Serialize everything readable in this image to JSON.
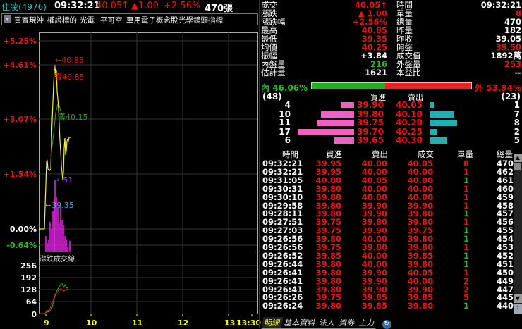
{
  "header": {
    "stock": "佳凌(4976)",
    "time": "09:32:21",
    "price": "40.05",
    "price_arrow": "↑",
    "change": "▲1.00",
    "change_pct": "+2.56%",
    "volume": "470張"
  },
  "tags": [
    "買賣現沖",
    "權證標的",
    "光電",
    "平可空",
    "車用電子概念股",
    "光學鏡頭指標"
  ],
  "info": [
    {
      "l1": "成交",
      "v1": "40.05↑",
      "c1": "r",
      "l2": "時間",
      "v2": "09:32:21",
      "c2": "w"
    },
    {
      "l1": "漲跌",
      "v1": "▲ 1.00",
      "c1": "r",
      "l2": "單量",
      "v2": "8",
      "c2": "r"
    },
    {
      "l1": "漲跌幅",
      "v1": "+2.56%",
      "c1": "r",
      "l2": "總量",
      "v2": "470",
      "c2": "w"
    },
    {
      "l1": "最高",
      "v1": "40.85",
      "c1": "r",
      "l2": "昨量",
      "v2": "182",
      "c2": "w"
    },
    {
      "l1": "最低",
      "v1": "39.35",
      "c1": "r",
      "l2": "昨收",
      "v2": "39.05",
      "c2": "w"
    },
    {
      "l1": "均價",
      "v1": "40.25",
      "c1": "r",
      "l2": "開盤",
      "v2": "39.50",
      "c2": "r"
    },
    {
      "l1": "振幅",
      "v1": "+3.84",
      "c1": "w",
      "l2": "成交值",
      "v2": "1892萬",
      "c2": "w"
    },
    {
      "l1": "內盤量",
      "v1": "216",
      "c1": "g",
      "l2": "外盤量",
      "v2": "253",
      "c2": "r"
    },
    {
      "l1": "估計量",
      "v1": "1621",
      "c1": "w",
      "l2": "本益比",
      "v2": "--",
      "c2": "w"
    }
  ],
  "ratio": {
    "inner_label": "內",
    "inner_pct": "46.06%",
    "inner_value": 46.06,
    "outer_label": "外",
    "outer_pct": "53.94%"
  },
  "orderbook": {
    "bid_total": "(48)",
    "ask_total": "(23)",
    "bid_header": "買進",
    "ask_header": "賣出",
    "rows": [
      {
        "bid_qty": "4",
        "bid": "39.90",
        "ask": "40.05",
        "ask_qty": "1"
      },
      {
        "bid_qty": "10",
        "bid": "39.80",
        "ask": "40.10",
        "ask_qty": "7"
      },
      {
        "bid_qty": "11",
        "bid": "39.75",
        "ask": "40.20",
        "ask_qty": "8"
      },
      {
        "bid_qty": "17",
        "bid": "39.70",
        "ask": "40.25",
        "ask_qty": "2"
      },
      {
        "bid_qty": "6",
        "bid": "39.65",
        "ask": "40.30",
        "ask_qty": "5"
      }
    ]
  },
  "trades": {
    "headers": [
      "時間",
      "買進",
      "賣出",
      "成交",
      "單量",
      "總量"
    ],
    "rows": [
      [
        "09:32:21",
        "39.95",
        "40.00",
        "40.05",
        "8",
        "470",
        "r"
      ],
      [
        "09:32:21",
        "39.95",
        "40.00",
        "40.00",
        "1",
        "462",
        "r"
      ],
      [
        "09:31:05",
        "40.00",
        "40.05",
        "40.00",
        "1",
        "461",
        "g"
      ],
      [
        "09:30:31",
        "39.80",
        "40.00",
        "40.00",
        "1",
        "460",
        "r"
      ],
      [
        "09:30:10",
        "39.80",
        "40.00",
        "40.00",
        "1",
        "459",
        "r"
      ],
      [
        "09:29:58",
        "39.80",
        "39.90",
        "39.90",
        "1",
        "458",
        "r"
      ],
      [
        "09:28:11",
        "39.80",
        "39.90",
        "39.80",
        "1",
        "457",
        "g"
      ],
      [
        "09:27:51",
        "39.75",
        "39.80",
        "39.80",
        "1",
        "456",
        "r"
      ],
      [
        "09:27:03",
        "39.75",
        "39.90",
        "39.75",
        "1",
        "455",
        "g"
      ],
      [
        "09:26:56",
        "39.80",
        "40.00",
        "39.80",
        "1",
        "454",
        "g"
      ],
      [
        "09:26:56",
        "39.75",
        "39.80",
        "39.80",
        "1",
        "453",
        "r"
      ],
      [
        "09:26:52",
        "39.85",
        "40.00",
        "39.85",
        "1",
        "452",
        "g"
      ],
      [
        "09:26:44",
        "39.80",
        "40.00",
        "39.80",
        "1",
        "451",
        "g"
      ],
      [
        "09:26:41",
        "39.80",
        "39.90",
        "40.05",
        "1",
        "450",
        "r"
      ],
      [
        "09:26:41",
        "39.80",
        "39.90",
        "40.00",
        "2",
        "449",
        "r"
      ],
      [
        "09:26:41",
        "39.80",
        "39.90",
        "39.90",
        "2",
        "447",
        "r"
      ],
      [
        "09:26:26",
        "39.75",
        "39.85",
        "39.85",
        "5",
        "445",
        "r"
      ],
      [
        "09:26:24",
        "39.80",
        "39.85",
        "39.80",
        "1",
        "440",
        "g"
      ]
    ]
  },
  "tabs": [
    "明細",
    "基本資料",
    "法人",
    "資券",
    "主力"
  ],
  "chart": {
    "y_labels": [
      "+5.25%",
      "+4.61%",
      "+3.07%",
      "+1.54%",
      "0.00%",
      "-0.64%"
    ],
    "high_label": "←40.85",
    "sell_high_label": "賣40.85",
    "avg_label": "壽40.15",
    "low_label": "←39.35",
    "vol_label": "←51",
    "sub_title": "漲跌成交線",
    "sub_y_labels": [
      "256",
      "192",
      "128",
      "64",
      "0"
    ],
    "x_labels": [
      "9",
      "10",
      "11",
      "12",
      "13",
      "13:30"
    ]
  }
}
